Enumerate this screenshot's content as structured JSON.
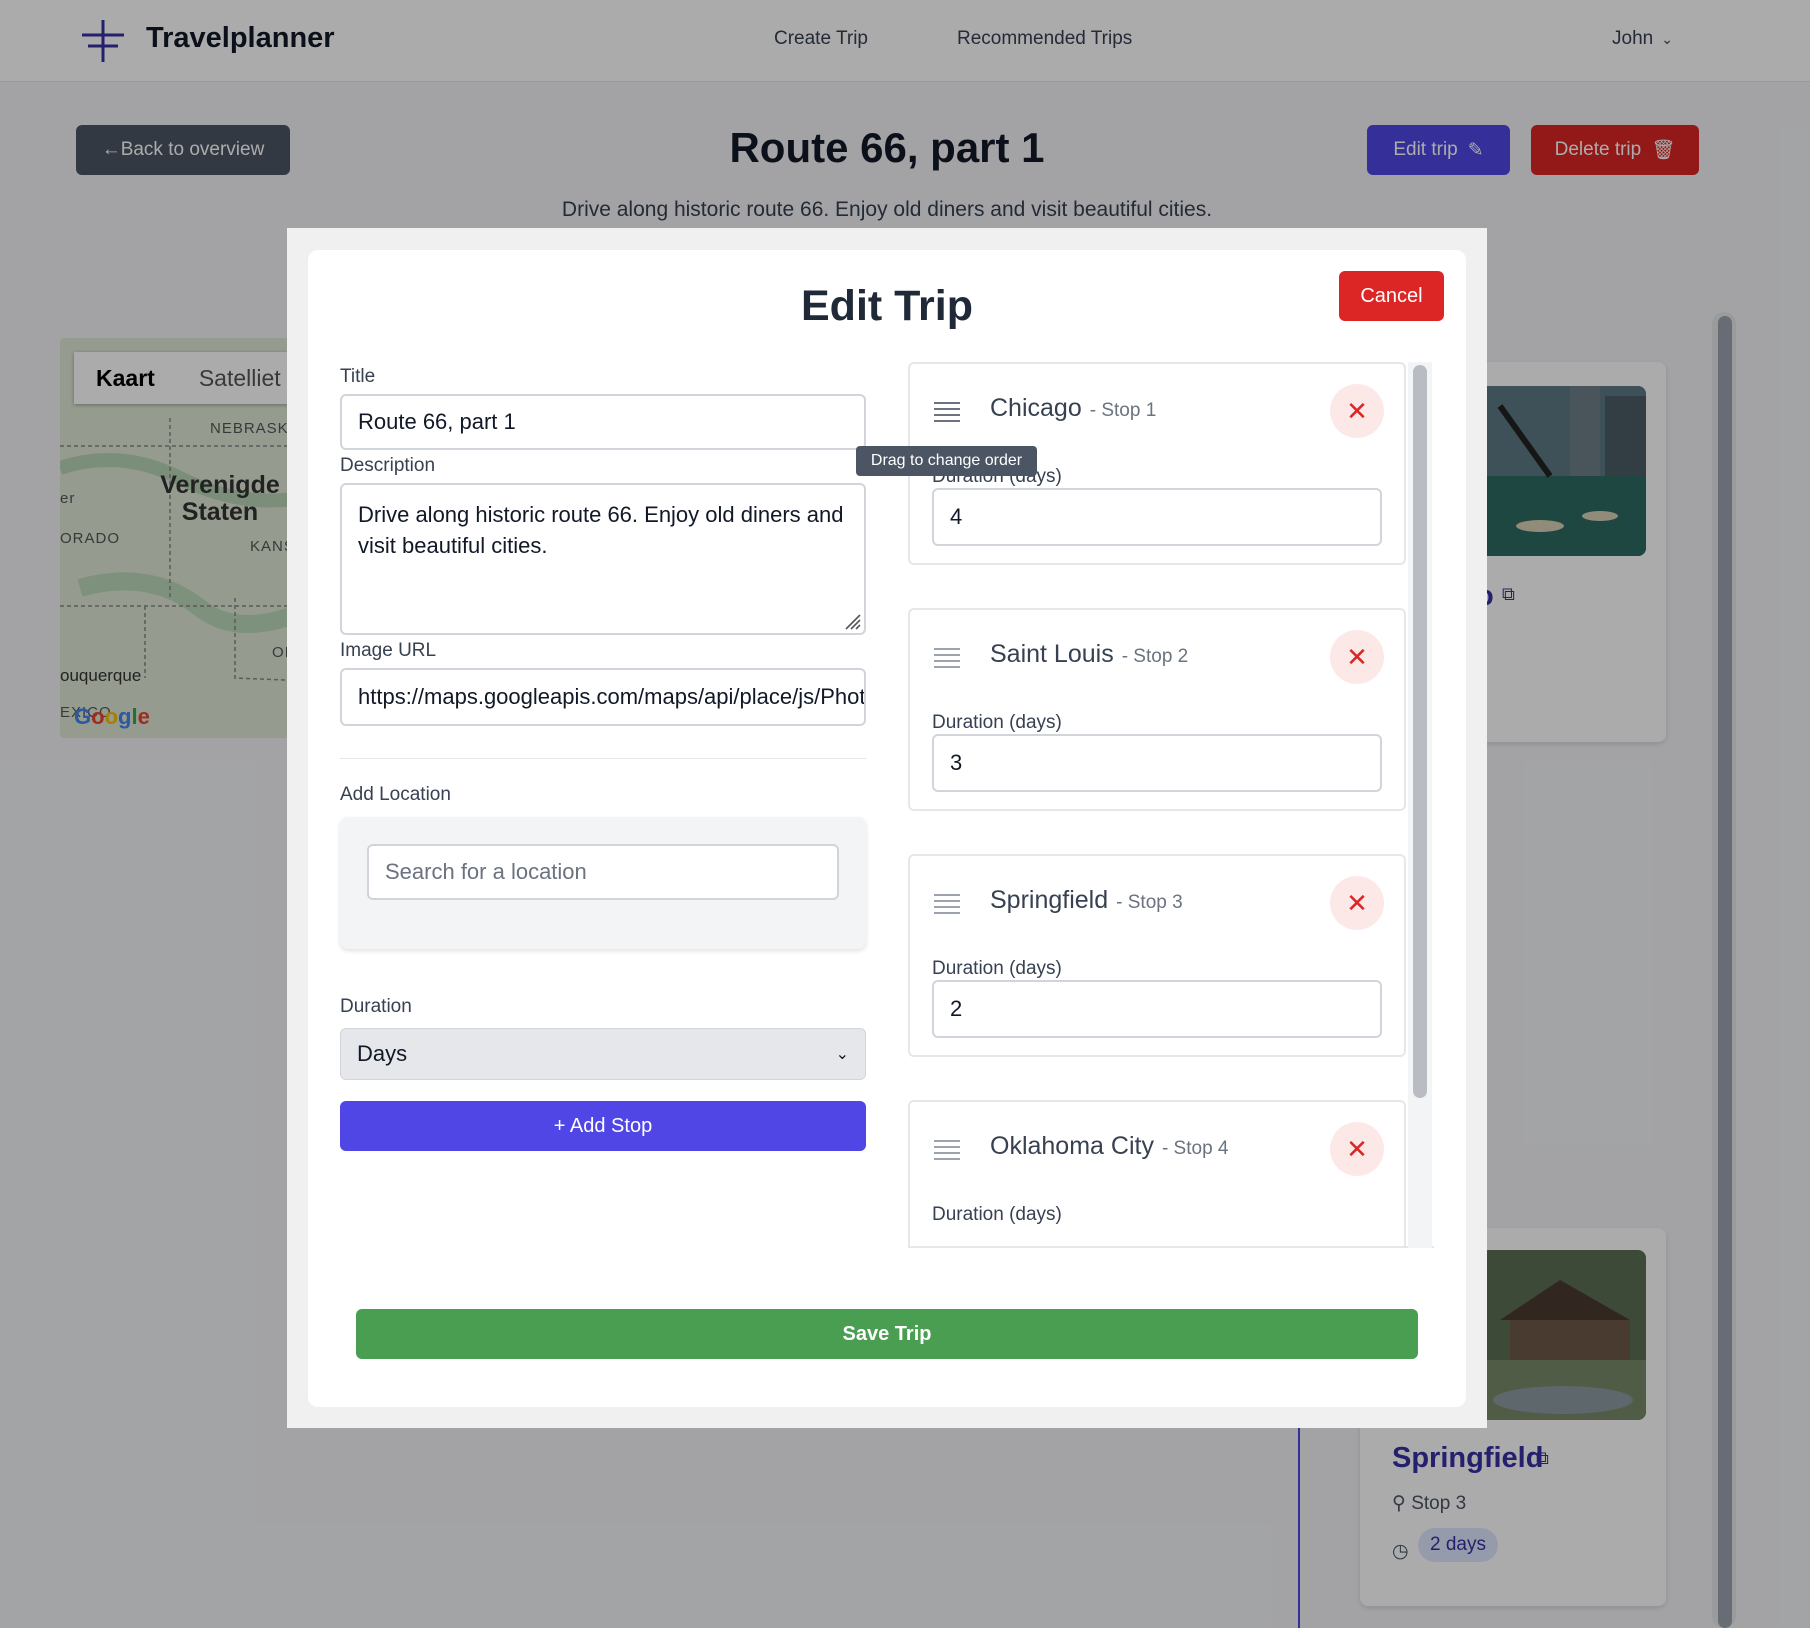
{
  "nav": {
    "brand": "Travelplanner",
    "links": [
      "Create Trip",
      "Recommended Trips"
    ],
    "user": "John"
  },
  "trip": {
    "back_label": "Back to overview",
    "title": "Route 66, part 1",
    "description": "Drive along historic route 66. Enjoy old diners and visit beautiful cities.",
    "edit_label": "Edit trip",
    "delete_label": "Delete trip"
  },
  "map": {
    "tabs": [
      "Kaart",
      "Satelliet"
    ],
    "labels": {
      "nebraska": "NEBRASK",
      "country": "Verenigde Staten",
      "kansas": "KANS",
      "colorado": "ORADO",
      "denver": "er",
      "ok": "OI",
      "albuquerque": "ouquerque",
      "mexico": "EXICO",
      "google": "Google"
    }
  },
  "background_stops": [
    {
      "name": "Chicago",
      "visible_name": "o"
    },
    {
      "name": "Springfield",
      "stop": "Stop 3",
      "days": "2 days"
    }
  ],
  "modal": {
    "title": "Edit Trip",
    "cancel_label": "Cancel",
    "title_label": "Title",
    "title_value": "Route 66, part 1",
    "description_label": "Description",
    "description_value": "Drive along historic route 66. Enjoy old diners and visit beautiful cities.",
    "image_url_label": "Image URL",
    "image_url_value": "https://maps.googleapis.com/maps/api/place/js/PhotoService",
    "add_location_label": "Add Location",
    "search_placeholder": "Search for a location",
    "duration_label": "Duration",
    "duration_unit": "Days",
    "add_stop_label": "+ Add Stop",
    "save_label": "Save Trip",
    "tooltip": "Drag to change order",
    "duration_days_label": "Duration (days)",
    "stops": [
      {
        "name": "Chicago",
        "number": "- Stop 1",
        "duration": "4"
      },
      {
        "name": "Saint Louis",
        "number": "- Stop 2",
        "duration": "3"
      },
      {
        "name": "Springfield",
        "number": "- Stop 3",
        "duration": "2"
      },
      {
        "name": "Oklahoma City",
        "number": "- Stop 4",
        "duration": ""
      }
    ]
  },
  "colors": {
    "primary": "#4f46e5",
    "danger": "#dc2626",
    "success": "#4a9e51"
  }
}
